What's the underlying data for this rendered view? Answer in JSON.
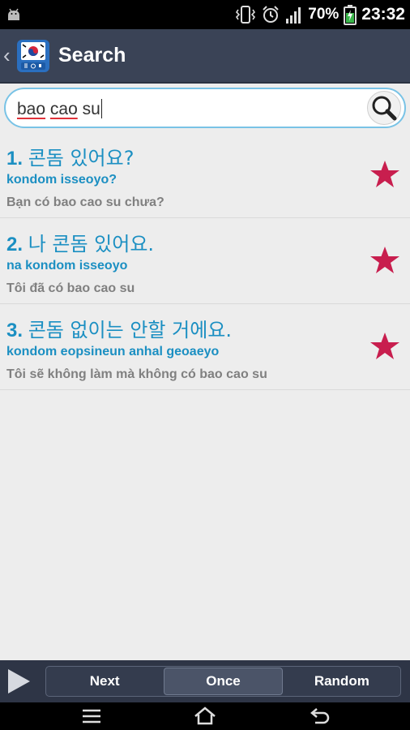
{
  "status_bar": {
    "battery_percent": "70%",
    "time": "23:32",
    "icons": [
      "android-debug-icon",
      "vibrate-icon",
      "alarm-icon",
      "signal-icon",
      "battery-charging-icon"
    ]
  },
  "app_bar": {
    "title": "Search",
    "icons": [
      "back-chevron-icon",
      "app-flag-icon"
    ]
  },
  "search": {
    "query_words": [
      "bao",
      "cao",
      "su"
    ],
    "search_icon": "magnifier-icon"
  },
  "results": [
    {
      "number": "1.",
      "korean": "콘돔 있어요?",
      "romanization": "kondom isseoyo?",
      "vietnamese": "Bạn có bao cao su chưa?",
      "favorite": true
    },
    {
      "number": "2.",
      "korean": "나 콘돔 있어요.",
      "romanization": "na kondom isseoyo",
      "vietnamese": "Tôi đã có bao cao su",
      "favorite": true
    },
    {
      "number": "3.",
      "korean": "콘돔 없이는 안할 거에요.",
      "romanization": "kondom eopsineun anhal geoaeyo",
      "vietnamese": "Tôi sẽ không làm mà không có bao cao su",
      "favorite": true
    }
  ],
  "playback": {
    "play_icon": "play-icon",
    "modes": [
      "Next",
      "Once",
      "Random"
    ],
    "selected_mode": "Once"
  },
  "nav_bar": {
    "icons": [
      "menu-icon",
      "home-icon",
      "back-icon"
    ]
  },
  "colors": {
    "accent_blue": "#1b8fc2",
    "star_red": "#c81e4e",
    "app_bar": "#3a4356"
  }
}
